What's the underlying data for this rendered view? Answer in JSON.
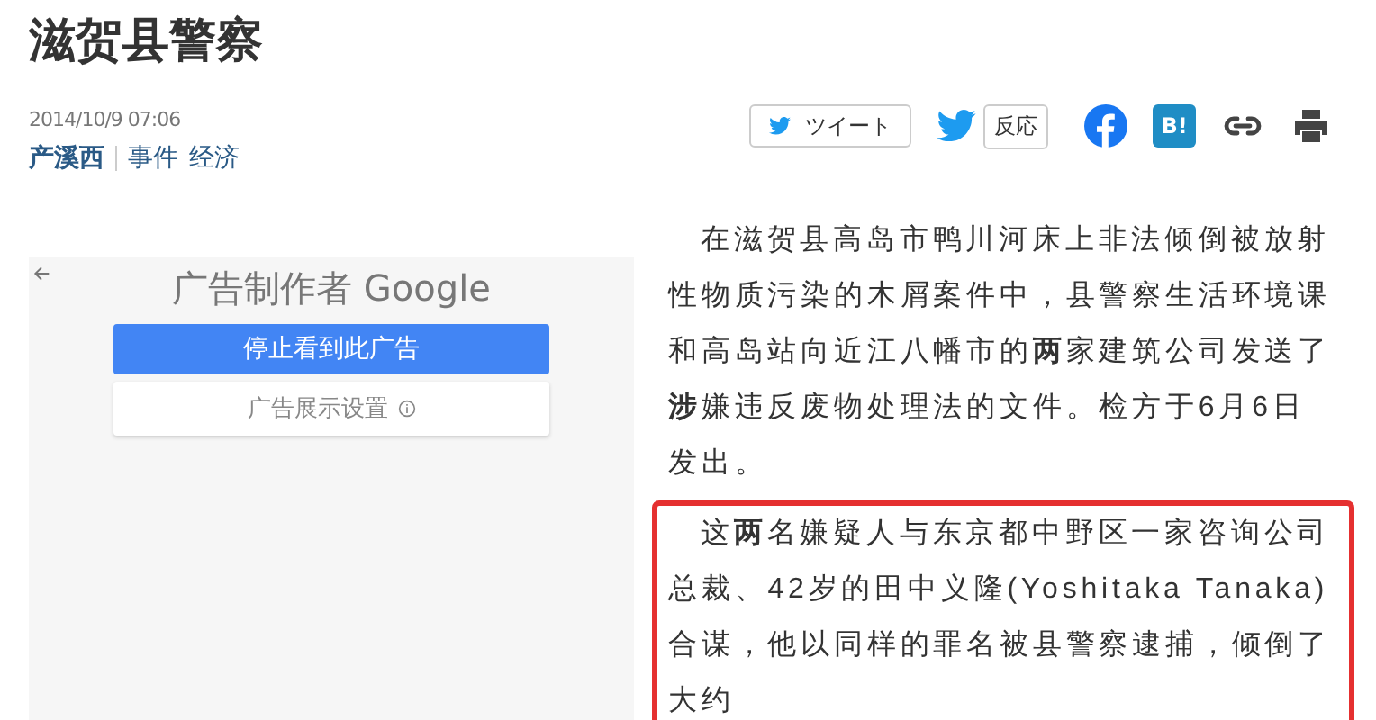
{
  "title": "滋贺县警察",
  "date": "2014/10/9 07:06",
  "tags": [
    {
      "label": "产溪西",
      "kind": "primary"
    },
    {
      "label": "事件",
      "kind": "normal"
    },
    {
      "label": "经济",
      "kind": "normal"
    }
  ],
  "share": {
    "tweet": "ツイート",
    "reaction": "反応",
    "hatena": "B!"
  },
  "ad": {
    "title": "广告制作者 Google",
    "stop_button": "停止看到此广告",
    "settings_button": "广告展示设置"
  },
  "paragraphs": [
    {
      "text": "在滋贺县高岛市鸭川河床上非法倾倒被放射性物质污染的木屑案件中，县警察生活环境课和高岛站向近江八幡市的**两**家建筑公司发送了**涉**嫌违反废物处理法的文件。检方于6月6日发出。",
      "highlighted": false
    },
    {
      "text": "这**两**名嫌疑人与东京都中野区一家咨询公司总裁、42岁的田中义隆(Yoshitaka Tanaka) 合谋，他以同样的罪名被县警察逮捕，倾倒了大约",
      "highlighted": true
    }
  ]
}
